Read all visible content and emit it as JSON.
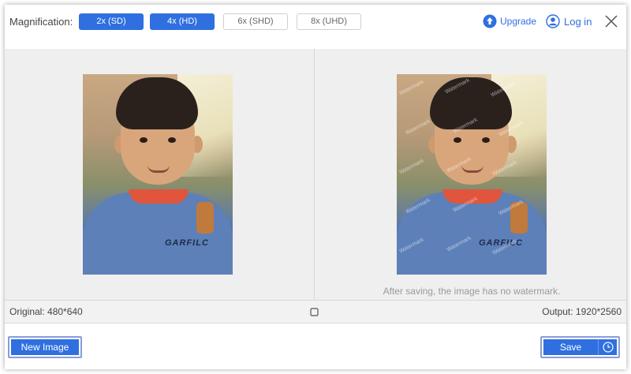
{
  "toolbar": {
    "magnification_label": "Magnification:",
    "options": [
      {
        "label": "2x (SD)",
        "active": true
      },
      {
        "label": "4x (HD)",
        "active": true
      },
      {
        "label": "6x (SHD)",
        "active": false
      },
      {
        "label": "8x (UHD)",
        "active": false
      }
    ],
    "upgrade_label": "Upgrade",
    "login_label": "Log in",
    "icons": {
      "upgrade": "upload-arrow-icon",
      "login": "user-icon",
      "close": "close-icon"
    }
  },
  "preview": {
    "watermark_text": "Watermark",
    "no_watermark_note": "After saving, the image has no watermark."
  },
  "info": {
    "original": "Original: 480*640",
    "output": "Output: 1920*2560"
  },
  "actions": {
    "new_image_label": "New Image",
    "save_label": "Save"
  },
  "colors": {
    "accent": "#2f6fe0",
    "panel": "#efefef"
  }
}
